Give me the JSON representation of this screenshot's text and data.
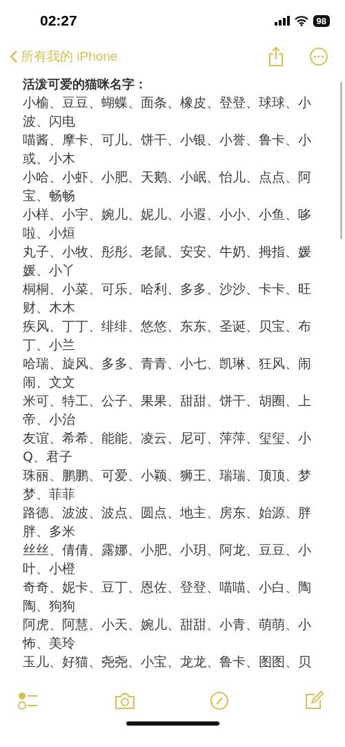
{
  "status_bar": {
    "time": "02:27",
    "battery": "98"
  },
  "nav": {
    "back_label": "所有我的 iPhone"
  },
  "note": {
    "title": "活泼可爱的猫咪名字：",
    "paragraphs": [
      "小榆、豆豆、蝴蝶、面条、橡皮、登登、球球、小波、闪电",
      "喵酱、摩卡、可儿、饼干、小银、小誉、鲁卡、小或、小木",
      "小哈、小虾、小肥、天鹅、小岷、怡儿、点点、阿宝、畅畅",
      "小样、小宇、婉儿、妮儿、小遐、小小、小鱼、哆啦、小烜",
      "丸子、小牧、彤彤、老鼠、安安、牛奶、拇指、媛媛、小丫",
      "桐桐、小菜、可乐、哈利、多多、沙沙、卡卡、旺财、木木",
      "疾风、丁丁、绯绯、悠悠、东东、圣诞、贝宝、布丁、小兰",
      "哈瑞、旋风、多多、青青、小七、凯琳、狂风、闹闹、文文",
      "米可、特工、公子、果果、甜甜、饼干、胡圈、上帝、小治",
      "友谊、希希、能能、凌云、尼可、萍萍、玺玺、小Q、君子",
      "珠丽、鹏鹏、可爱、小颖、狮王、瑞瑞、顶顶、梦梦、菲菲",
      "路德、波波、波点、圆点、地主、房东、始源、胖胖、多米",
      "丝丝、倩倩、露娜、小肥、小玥、阿龙、豆豆、小叶、小橙",
      "奇奇、妮卡、豆丁、恩佐、登登、喵喵、小白、陶陶、狗狗",
      "阿虎、阿慧、小天、婉儿、甜甜、小青、萌萌、小怖、美玲",
      "玉儿、好猫、尧尧、小宝、龙龙、鲁卡、图图、贝"
    ]
  },
  "toolbar": [
    {
      "kind": "checklist"
    },
    {
      "kind": "camera"
    },
    {
      "kind": "markup"
    },
    {
      "kind": "compose"
    }
  ]
}
